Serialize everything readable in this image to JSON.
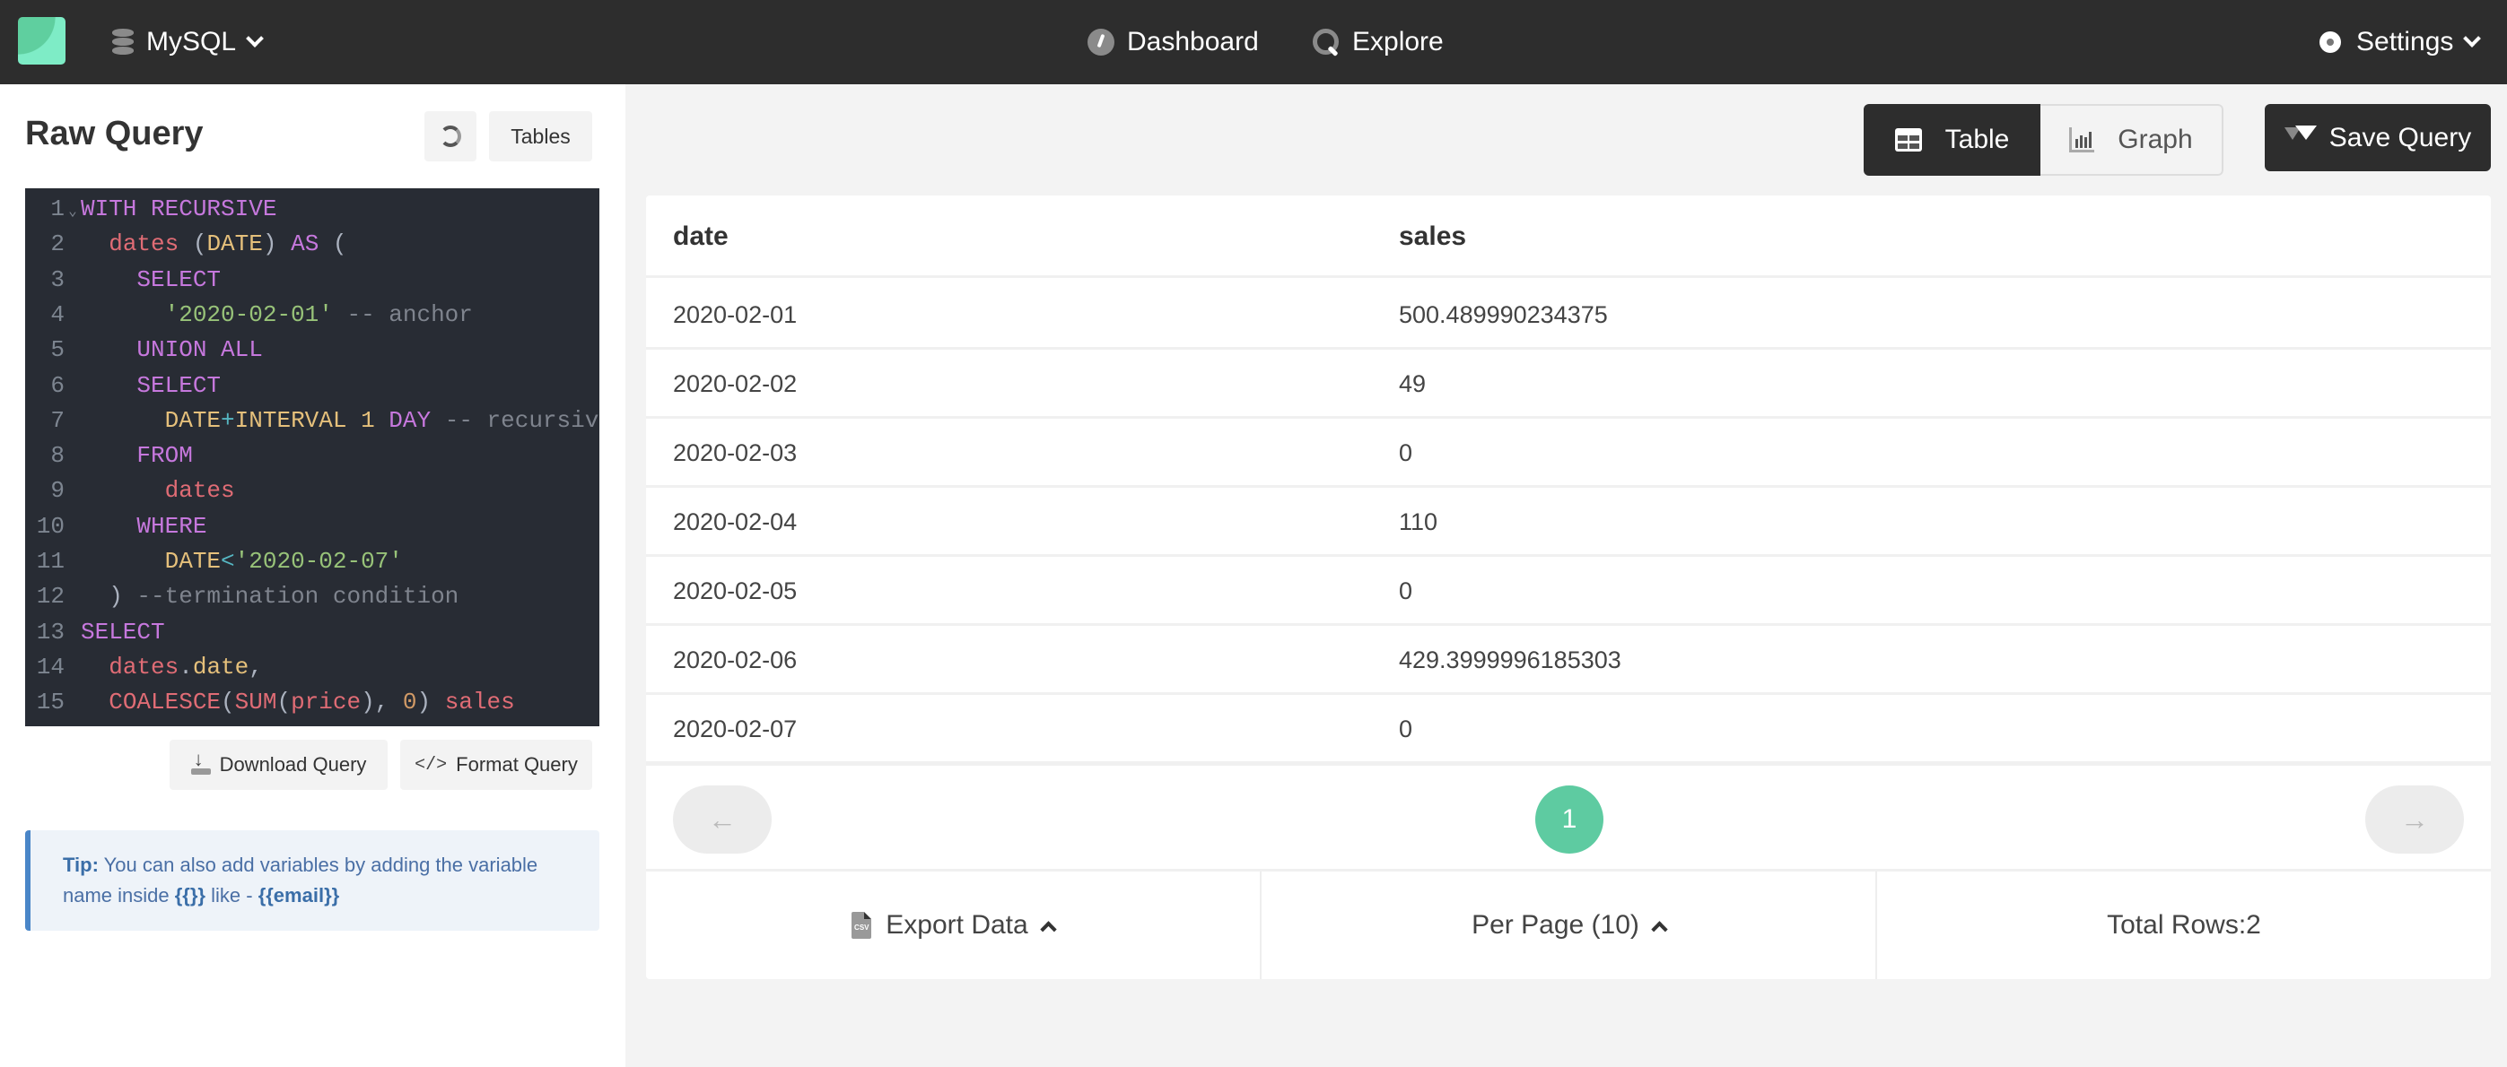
{
  "header": {
    "db_selector": {
      "label": "MySQL",
      "icon": "database-icon"
    },
    "nav": [
      {
        "label": "Dashboard",
        "icon": "gauge-icon"
      },
      {
        "label": "Explore",
        "icon": "search-icon"
      }
    ],
    "settings": {
      "label": "Settings",
      "icon": "gear-icon"
    }
  },
  "sidebar": {
    "title": "Raw Query",
    "refresh_icon": "refresh-icon",
    "tables_label": "Tables",
    "editor": {
      "lines": [
        {
          "n": "1",
          "fold": "⌄",
          "tokens": [
            [
              "kw",
              "WITH RECURSIVE"
            ]
          ]
        },
        {
          "n": "2",
          "tokens": [
            [
              "pl",
              "  "
            ],
            [
              "tbl",
              "dates"
            ],
            [
              "pl",
              " ("
            ],
            [
              "typ",
              "DATE"
            ],
            [
              "pl",
              ") "
            ],
            [
              "kw",
              "AS"
            ],
            [
              "pl",
              " ("
            ]
          ]
        },
        {
          "n": "3",
          "tokens": [
            [
              "pl",
              "    "
            ],
            [
              "kw",
              "SELECT"
            ]
          ]
        },
        {
          "n": "4",
          "tokens": [
            [
              "pl",
              "      "
            ],
            [
              "str",
              "'2020-02-01'"
            ],
            [
              "cm",
              " -- anchor"
            ]
          ]
        },
        {
          "n": "5",
          "tokens": [
            [
              "pl",
              "    "
            ],
            [
              "kw",
              "UNION ALL"
            ]
          ]
        },
        {
          "n": "6",
          "tokens": [
            [
              "pl",
              "    "
            ],
            [
              "kw",
              "SELECT"
            ]
          ]
        },
        {
          "n": "7",
          "tokens": [
            [
              "pl",
              "      "
            ],
            [
              "typ",
              "DATE"
            ],
            [
              "op",
              "+"
            ],
            [
              "typ",
              "INTERVAL 1"
            ],
            [
              "pl",
              " "
            ],
            [
              "kw",
              "DAY"
            ],
            [
              "cm",
              " -- recursive"
            ]
          ]
        },
        {
          "n": "8",
          "tokens": [
            [
              "pl",
              "    "
            ],
            [
              "kw",
              "FROM"
            ]
          ]
        },
        {
          "n": "9",
          "tokens": [
            [
              "pl",
              "      "
            ],
            [
              "tbl",
              "dates"
            ]
          ]
        },
        {
          "n": "10",
          "tokens": [
            [
              "pl",
              "    "
            ],
            [
              "kw",
              "WHERE"
            ]
          ]
        },
        {
          "n": "11",
          "tokens": [
            [
              "pl",
              "      "
            ],
            [
              "typ",
              "DATE"
            ],
            [
              "op",
              "<"
            ],
            [
              "str",
              "'2020-02-07'"
            ]
          ]
        },
        {
          "n": "12",
          "tokens": [
            [
              "pl",
              "  ) "
            ],
            [
              "cm",
              "--termination condition"
            ]
          ]
        },
        {
          "n": "13",
          "tokens": [
            [
              "kw",
              "SELECT"
            ]
          ]
        },
        {
          "n": "14",
          "tokens": [
            [
              "pl",
              "  "
            ],
            [
              "tbl",
              "dates"
            ],
            [
              "pl",
              "."
            ],
            [
              "typ",
              "date"
            ],
            [
              "pl",
              ","
            ]
          ]
        },
        {
          "n": "15",
          "tokens": [
            [
              "pl",
              "  "
            ],
            [
              "tbl",
              "COALESCE"
            ],
            [
              "pl",
              "("
            ],
            [
              "tbl",
              "SUM"
            ],
            [
              "pl",
              "("
            ],
            [
              "tbl",
              "price"
            ],
            [
              "pl",
              "), "
            ],
            [
              "num",
              "0"
            ],
            [
              "pl",
              ") "
            ],
            [
              "tbl",
              "sales"
            ]
          ]
        }
      ]
    },
    "download_label": "Download Query",
    "format_label": "Format Query",
    "tip": {
      "prefix": "Tip:",
      "text1": " You can also add variables by adding the variable name inside ",
      "braces": "{{}}",
      "text2": " like - ",
      "example": "{{email}}"
    }
  },
  "main": {
    "view_toggle": [
      {
        "label": "Table",
        "icon": "table-icon",
        "active": true
      },
      {
        "label": "Graph",
        "icon": "bar-chart-icon",
        "active": false
      }
    ],
    "save_query_label": "Save Query",
    "table": {
      "columns": [
        "date",
        "sales"
      ],
      "rows": [
        [
          "2020-02-01",
          "500.489990234375"
        ],
        [
          "2020-02-02",
          "49"
        ],
        [
          "2020-02-03",
          "0"
        ],
        [
          "2020-02-04",
          "110"
        ],
        [
          "2020-02-05",
          "0"
        ],
        [
          "2020-02-06",
          "429.3999996185303"
        ],
        [
          "2020-02-07",
          "0"
        ]
      ]
    },
    "pagination": {
      "prev": "←",
      "current_page": "1",
      "next": "→"
    },
    "footer": {
      "export_label": "Export Data",
      "per_page_label": "Per Page (10)",
      "total_rows_label": "Total Rows:2"
    }
  },
  "colors": {
    "header_bg": "#2d2d2d",
    "accent_green": "#5ecba1",
    "tip_border": "#4a86c8",
    "editor_bg": "#282c34"
  }
}
